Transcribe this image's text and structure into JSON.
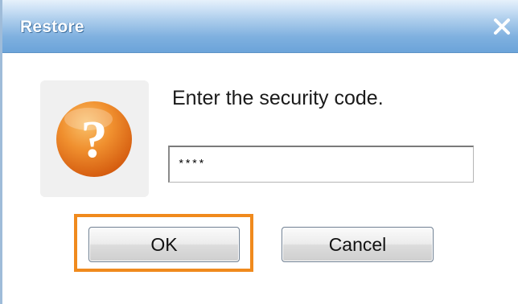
{
  "window": {
    "title": "Restore",
    "close_label": "X"
  },
  "dialog": {
    "icon": "question-mark-icon",
    "icon_glyph": "?",
    "prompt": "Enter the security code.",
    "security_code": {
      "value": "****"
    },
    "buttons": {
      "ok_label": "OK",
      "cancel_label": "Cancel"
    }
  },
  "colors": {
    "titlebar": "#7fb0df",
    "highlight": "#f08a1d",
    "icon_orange": "#e8731e"
  }
}
